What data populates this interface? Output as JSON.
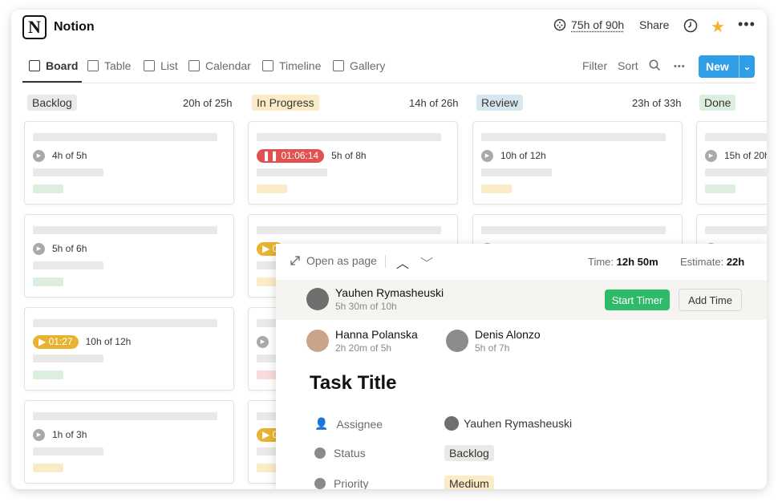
{
  "app": {
    "name": "Notion",
    "hours": "75h of 90h",
    "share": "Share"
  },
  "tabs": [
    {
      "label": "Board",
      "icon": "board-icon"
    },
    {
      "label": "Table",
      "icon": "table-icon"
    },
    {
      "label": "List",
      "icon": "list-icon"
    },
    {
      "label": "Calendar",
      "icon": "calendar-icon"
    },
    {
      "label": "Timeline",
      "icon": "timeline-icon"
    },
    {
      "label": "Gallery",
      "icon": "gallery-icon"
    }
  ],
  "view_actions": {
    "filter": "Filter",
    "sort": "Sort",
    "new": "New"
  },
  "columns": [
    {
      "name": "Backlog",
      "hours": "20h of 25h",
      "color": "#e9e9e7"
    },
    {
      "name": "In Progress",
      "hours": "14h of 26h",
      "color": "#fbecc8"
    },
    {
      "name": "Review",
      "hours": "23h of 33h",
      "color": "#d8e6f0"
    },
    {
      "name": "Done",
      "hours": "",
      "color": "#dceedd"
    }
  ],
  "cards": {
    "backlog": [
      {
        "progress": "4h of 5h"
      },
      {
        "progress": "5h of 6h"
      },
      {
        "timer": "01:27",
        "progress": "10h of 12h"
      },
      {
        "progress": "1h of 3h"
      }
    ],
    "in_progress": [
      {
        "timer": "01:06:14",
        "progress": "5h of 8h"
      },
      {
        "timer": "0"
      },
      {},
      {
        "timer": "0"
      }
    ],
    "review": [
      {
        "progress": "10h of 12h"
      }
    ],
    "done": [
      {
        "progress": "15h of 20h"
      }
    ]
  },
  "panel": {
    "open_as_page": "Open as page",
    "time_label": "Time:",
    "time_value": "12h 50m",
    "estimate_label": "Estimate:",
    "estimate_value": "22h",
    "main_user": {
      "name": "Yauhen Rymasheuski",
      "sub": "5h 30m of 10h"
    },
    "start_timer": "Start Timer",
    "add_time": "Add Time",
    "users": [
      {
        "name": "Hanna Polanska",
        "sub": "2h 20m of 5h"
      },
      {
        "name": "Denis Alonzo",
        "sub": "5h of 7h"
      }
    ],
    "task_title": "Task Title",
    "props": [
      {
        "label": "Assignee",
        "value": "Yauhen Rymasheuski",
        "icon": "person-icon"
      },
      {
        "label": "Status",
        "value": "Backlog",
        "icon": "status-icon"
      },
      {
        "label": "Priority",
        "value": "Medium",
        "icon": "priority-icon"
      }
    ]
  }
}
